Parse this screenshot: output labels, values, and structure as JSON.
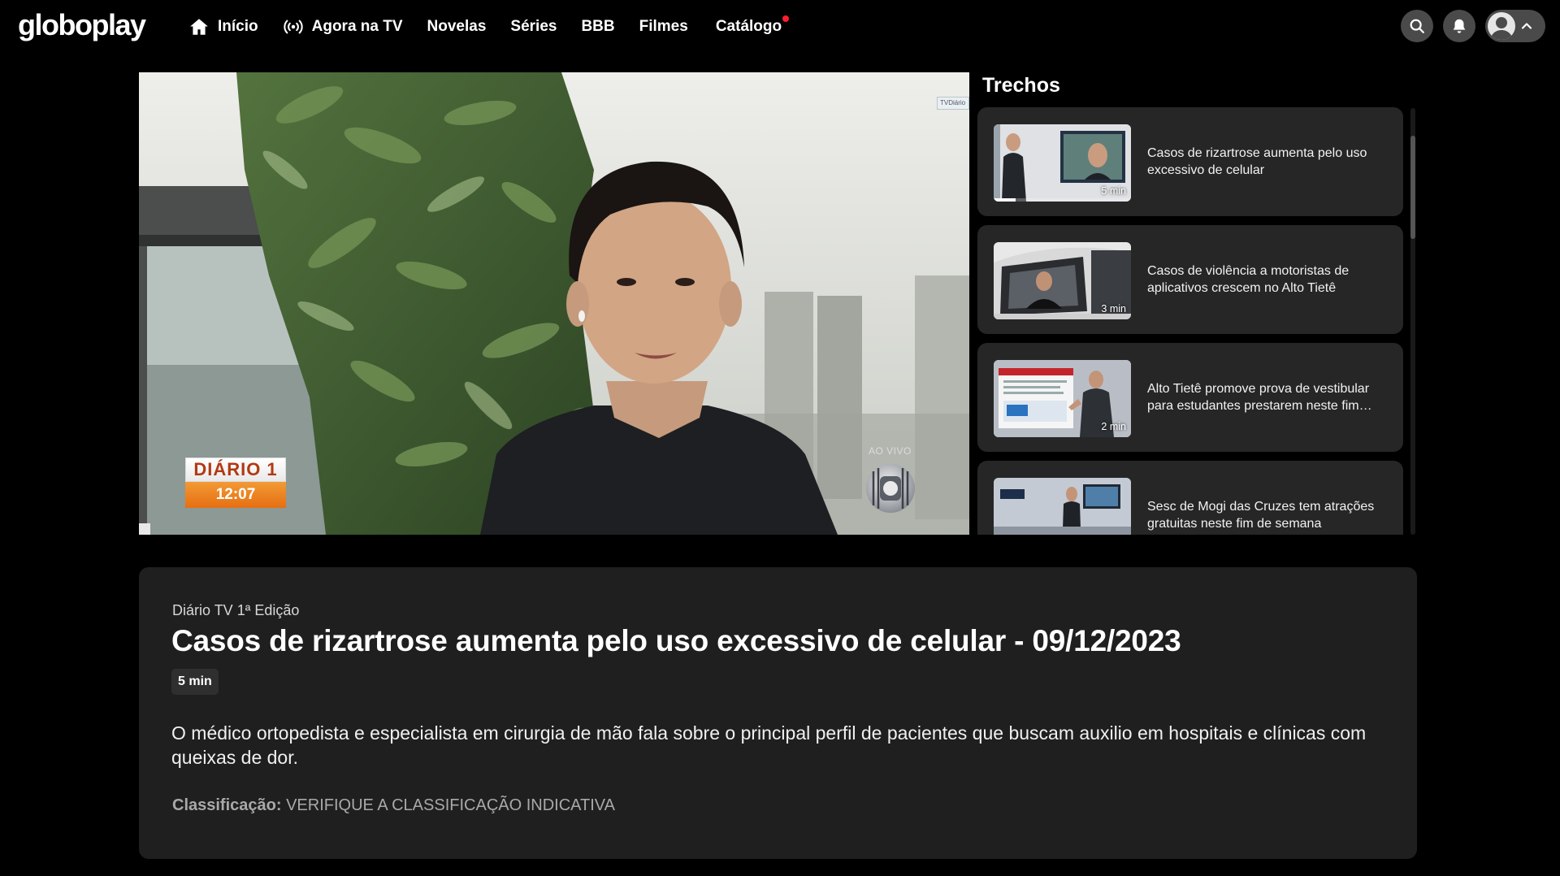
{
  "header": {
    "logo": "globoplay",
    "nav": [
      {
        "label": "Início",
        "icon": "home-icon"
      },
      {
        "label": "Agora na TV",
        "icon": "broadcast-icon"
      },
      {
        "label": "Novelas"
      },
      {
        "label": "Séries"
      },
      {
        "label": "BBB"
      },
      {
        "label": "Filmes"
      },
      {
        "label": "Catálogo",
        "badge_color": "#ff1e2d"
      }
    ],
    "icons": [
      "search-icon",
      "bell-icon",
      "avatar-icon",
      "chevron-up-icon"
    ]
  },
  "player": {
    "bug_top": "DIÁRIO 1",
    "bug_time": "12:07",
    "live_label": "AO VIVO",
    "corner_tag": "TVDiário"
  },
  "trechos": {
    "title": "Trechos",
    "items": [
      {
        "title": "Casos de rizartrose aumenta pelo uso excessivo de celular",
        "duration": "5 min",
        "progress": 0.16
      },
      {
        "title": "Casos de violência a motoristas de aplicativos crescem no Alto Tietê",
        "duration": "3 min"
      },
      {
        "title": "Alto Tietê promove prova de vestibular para estudantes prestarem neste fim…",
        "duration": "2 min"
      },
      {
        "title": "Sesc de Mogi das Cruzes tem atrações gratuitas neste fim de semana",
        "duration": ""
      }
    ]
  },
  "info": {
    "program": "Diário TV 1ª Edição",
    "title": "Casos de rizartrose aumenta pelo uso excessivo de celular - 09/12/2023",
    "duration": "5 min",
    "description": "O médico ortopedista e especialista em cirurgia de mão fala sobre o principal perfil de pacientes que buscam auxilio em hospitais e clínicas com queixas de dor.",
    "rating_label": "Classificação:",
    "rating_value": "VERIFIQUE A CLASSIFICAÇÃO INDICATIVA"
  },
  "colors": {
    "background": "#000000",
    "card": "#262626",
    "panel": "#1f1f1f",
    "accent_dot": "#ff1e2d"
  }
}
